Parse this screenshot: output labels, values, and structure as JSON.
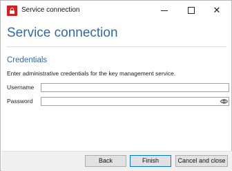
{
  "window": {
    "title": "Service connection",
    "controls": {
      "minimize": "minimize",
      "maximize": "maximize",
      "close": "✕"
    }
  },
  "header": {
    "title": "Service connection"
  },
  "section": {
    "title": "Credentials",
    "description": "Enter administrative credentials for the key management service."
  },
  "form": {
    "username_label": "Username",
    "username_value": "",
    "password_label": "Password",
    "password_value": ""
  },
  "footer": {
    "back_label": "Back",
    "finish_label": "Finish",
    "cancel_label": "Cancel and close"
  },
  "icons": {
    "app": "lock-icon",
    "reveal": "eye-icon"
  },
  "colors": {
    "accent": "#2e6aa7",
    "app_icon": "#d42020",
    "footer_bg": "#f0f0f0",
    "default_button_border": "#0078d7"
  }
}
